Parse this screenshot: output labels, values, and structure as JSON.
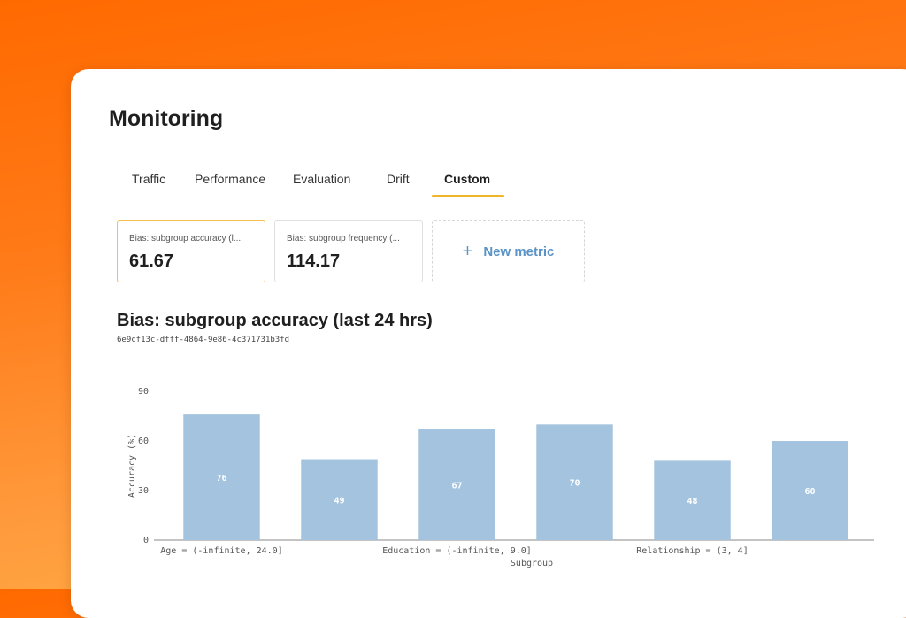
{
  "page": {
    "title": "Monitoring"
  },
  "tabs": [
    {
      "label": "Traffic",
      "active": false
    },
    {
      "label": "Performance",
      "active": false
    },
    {
      "label": "Evaluation",
      "active": false
    },
    {
      "label": "Drift",
      "active": false
    },
    {
      "label": "Custom",
      "active": true
    }
  ],
  "metrics": [
    {
      "label": "Bias: subgroup accuracy (l...",
      "value": "61.67",
      "selected": true
    },
    {
      "label": "Bias: subgroup frequency (...",
      "value": "114.17",
      "selected": false
    }
  ],
  "new_metric": {
    "icon": "plus-icon",
    "label": "New metric"
  },
  "chart_section": {
    "title": "Bias: subgroup accuracy (last 24 hrs)",
    "id": "6e9cf13c-dfff-4864-9e86-4c371731b3fd"
  },
  "colors": {
    "bar": "#a4c3de",
    "accent": "#f0b429",
    "link": "#5b93c6"
  },
  "chart_data": {
    "type": "bar",
    "categories": [
      "Age = (-infinite, 24.0]",
      "",
      "Education = (-infinite, 9.0]",
      "",
      "Relationship = (3, 4]",
      ""
    ],
    "values": [
      76,
      49,
      67,
      70,
      48,
      60
    ],
    "xlabel": "Subgroup",
    "ylabel": "Accuracy (%)",
    "ylim": [
      0,
      90
    ],
    "yticks": [
      0,
      30,
      60,
      90
    ],
    "grid": false,
    "data_labels": true
  }
}
